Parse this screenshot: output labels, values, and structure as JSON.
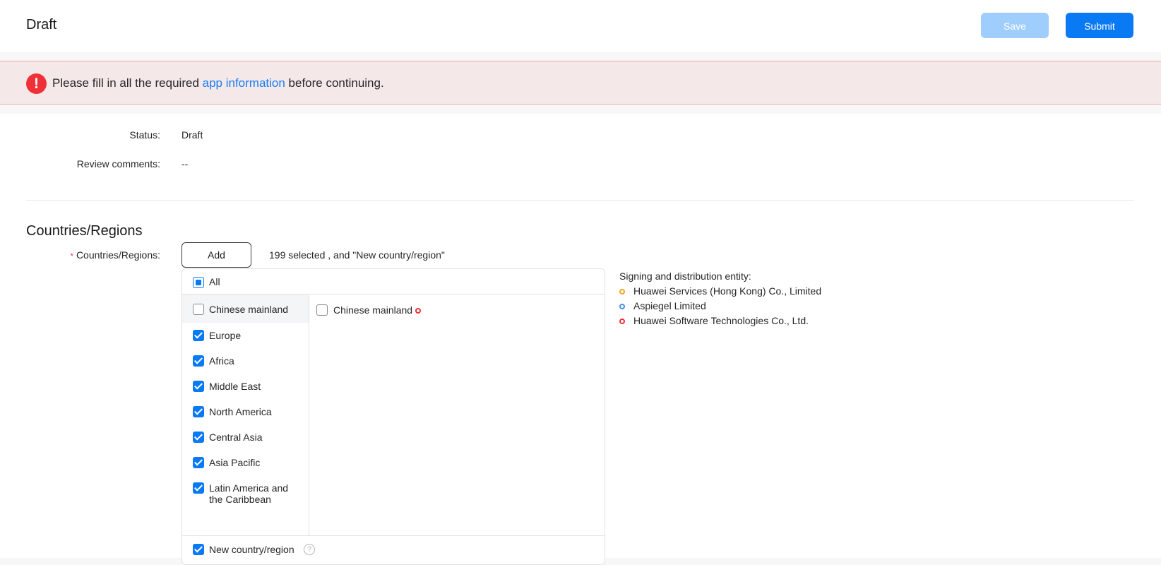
{
  "header": {
    "title": "Draft",
    "save_label": "Save",
    "submit_label": "Submit"
  },
  "alert": {
    "text_before": "Please fill in all the required ",
    "link_text": "app information",
    "text_after": " before continuing."
  },
  "status": {
    "label": "Status:",
    "value": "Draft"
  },
  "review": {
    "label": "Review comments:",
    "value": "--"
  },
  "section": {
    "title": "Countries/Regions"
  },
  "countries": {
    "label": "Countries/Regions:",
    "add_label": "Add",
    "selected_info": "199 selected , and \"New country/region\"",
    "all_label": "All",
    "regions": [
      {
        "label": "Chinese mainland",
        "checked": false
      },
      {
        "label": "Europe",
        "checked": true
      },
      {
        "label": "Africa",
        "checked": true
      },
      {
        "label": "Middle East",
        "checked": true
      },
      {
        "label": "North America",
        "checked": true
      },
      {
        "label": "Central Asia",
        "checked": true
      },
      {
        "label": "Asia Pacific",
        "checked": true
      },
      {
        "label": "Latin America and the Caribbean",
        "checked": true
      }
    ],
    "sub_items": [
      {
        "label": "Chinese mainland",
        "checked": false
      }
    ],
    "new_region_label": "New country/region",
    "help_glyph": "?"
  },
  "entities": {
    "title": "Signing and distribution entity:",
    "items": [
      {
        "label": "Huawei Services (Hong Kong) Co., Limited",
        "color": "#f5a623"
      },
      {
        "label": "Aspiegel Limited",
        "color": "#4a90e2"
      },
      {
        "label": "Huawei Software Technologies Co., Ltd.",
        "color": "#ef3038"
      }
    ]
  },
  "colors": {
    "primary": "#0a7af4",
    "primary_disabled": "#9fcefd",
    "error": "#ef3038",
    "link": "#1a7ef2"
  }
}
